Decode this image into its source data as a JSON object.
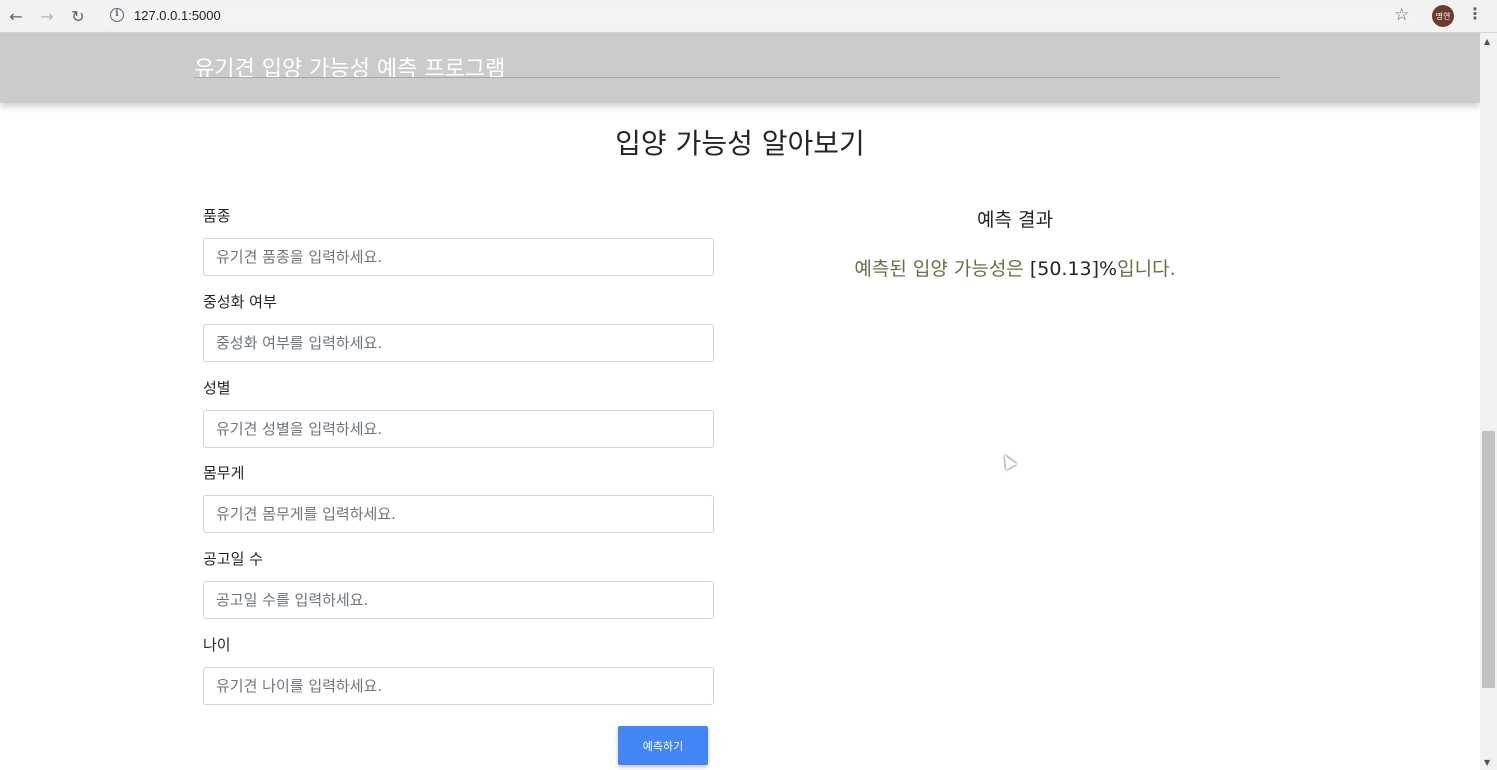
{
  "browser": {
    "url": "127.0.0.1:5000",
    "avatar_text": "명연",
    "back_icon": "←",
    "forward_icon": "→",
    "reload_icon": "↻",
    "star_icon": "☆",
    "menu_icon": "⋮",
    "info_icon": "i"
  },
  "header": {
    "title": "유기견 입양 가능성 예측 프로그램"
  },
  "main": {
    "heading": "입양 가능성 알아보기"
  },
  "form": {
    "fields": [
      {
        "label": "품종",
        "placeholder": "유기견 품종을 입력하세요.",
        "value": ""
      },
      {
        "label": "중성화 여부",
        "placeholder": "중성화 여부를 입력하세요.",
        "value": ""
      },
      {
        "label": "성별",
        "placeholder": "유기견 성별을 입력하세요.",
        "value": ""
      },
      {
        "label": "몸무게",
        "placeholder": "유기견 몸무게를 입력하세요.",
        "value": ""
      },
      {
        "label": "공고일 수",
        "placeholder": "공고일 수를 입력하세요.",
        "value": ""
      },
      {
        "label": "나이",
        "placeholder": "유기견 나이를 입력하세요.",
        "value": ""
      }
    ],
    "submit_label": "예측하기"
  },
  "result": {
    "title": "예측 결과",
    "prefix": "예측된 입양 가능성은",
    "value": "[50.13]%",
    "suffix": "입니다."
  },
  "colors": {
    "header_bg": "#cbcbcb",
    "button_bg": "#4285f4"
  }
}
